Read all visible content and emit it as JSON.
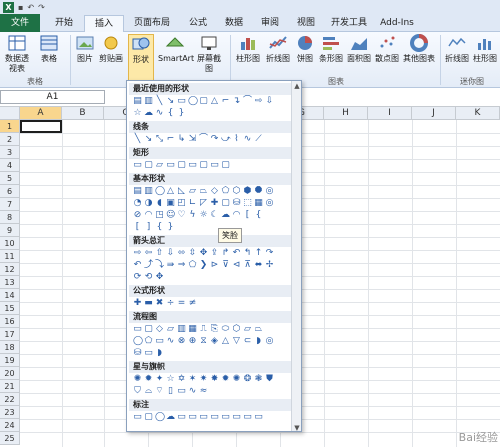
{
  "tabs": [
    "文件",
    "开始",
    "插入",
    "页面布局",
    "公式",
    "数据",
    "审阅",
    "视图",
    "开发工具",
    "Add-Ins"
  ],
  "ribbon": {
    "buttons": [
      "数据透视表",
      "表格",
      "图片",
      "剪贴画",
      "形状",
      "SmartArt",
      "屏幕截图",
      "柱形图",
      "折线图",
      "饼图",
      "条形图",
      "面积图",
      "散点图",
      "其他图表",
      "折线图",
      "柱形图",
      "迷你图"
    ],
    "groups": [
      "表格",
      "图表"
    ]
  },
  "namebox": "A1",
  "columns": [
    "A",
    "B",
    "C",
    "D",
    "E",
    "F",
    "G",
    "H",
    "I",
    "J",
    "K"
  ],
  "rows": [
    "1",
    "2",
    "3",
    "4",
    "5",
    "6",
    "7",
    "8",
    "9",
    "10",
    "11",
    "12",
    "13",
    "14",
    "15",
    "16",
    "17",
    "18",
    "19",
    "20",
    "21",
    "22",
    "23",
    "24",
    "25"
  ],
  "dropdown": {
    "sections": [
      "最近使用的形状",
      "线条",
      "矩形",
      "基本形状",
      "箭头总汇",
      "公式形状",
      "流程图",
      "星与旗帜",
      "标注"
    ]
  },
  "tooltip": "笑脸",
  "watermark": "Bai经验"
}
